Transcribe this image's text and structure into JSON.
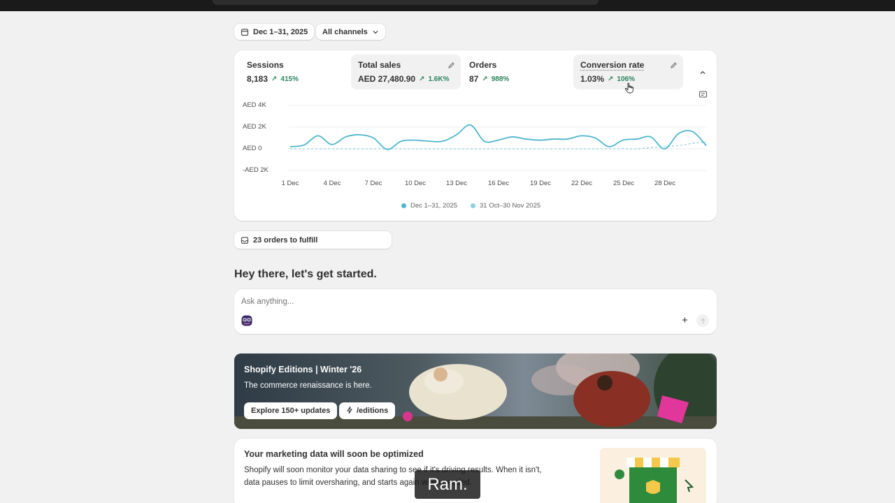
{
  "filters": {
    "date_range": "Dec 1–31, 2025",
    "channel": "All channels"
  },
  "metrics": [
    {
      "label": "Sessions",
      "value": "8,183",
      "change": "415%"
    },
    {
      "label": "Total sales",
      "value": "AED 27,480.90",
      "change": "1.6K%"
    },
    {
      "label": "Orders",
      "value": "87",
      "change": "988%"
    },
    {
      "label": "Conversion rate",
      "value": "1.03%",
      "change": "106%"
    }
  ],
  "chart_data": {
    "type": "line",
    "y_ticks": [
      "AED 4K",
      "AED 2K",
      "AED 0",
      "-AED 2K"
    ],
    "ylim": [
      -2000,
      4000
    ],
    "x_ticks": [
      "1 Dec",
      "4 Dec",
      "7 Dec",
      "10 Dec",
      "13 Dec",
      "16 Dec",
      "19 Dec",
      "22 Dec",
      "25 Dec",
      "28 Dec"
    ],
    "series": [
      {
        "name": "Dec 1–31, 2025",
        "color": "#4cb6cf",
        "dashed": false,
        "x": [
          1,
          2,
          3,
          4,
          5,
          6,
          7,
          8,
          9,
          10,
          11,
          12,
          13,
          14,
          15,
          16,
          17,
          18,
          19,
          20,
          21,
          22,
          23,
          24,
          25,
          26,
          27,
          28,
          29,
          30,
          31
        ],
        "values": [
          200,
          350,
          1200,
          400,
          1100,
          1300,
          1000,
          -50,
          700,
          800,
          700,
          700,
          1300,
          2200,
          700,
          800,
          1100,
          900,
          800,
          900,
          900,
          1200,
          1000,
          200,
          800,
          900,
          1100,
          0,
          1400,
          1600,
          300
        ]
      },
      {
        "name": "31 Oct–30 Nov 2025",
        "color": "#8fd0e0",
        "dashed": true,
        "x": [
          1,
          2,
          3,
          4,
          5,
          6,
          7,
          8,
          9,
          10,
          11,
          12,
          13,
          14,
          15,
          16,
          17,
          18,
          19,
          20,
          21,
          22,
          23,
          24,
          25,
          26,
          27,
          28,
          29,
          30,
          31
        ],
        "values": [
          0,
          0,
          0,
          0,
          0,
          0,
          0,
          0,
          0,
          0,
          0,
          0,
          0,
          0,
          0,
          0,
          0,
          0,
          0,
          0,
          0,
          0,
          0,
          0,
          0,
          0,
          100,
          200,
          300,
          500,
          650
        ]
      }
    ]
  },
  "orders_to_fulfill": "23 orders to fulfill",
  "greeting": "Hey there, let's get started.",
  "ask": {
    "placeholder": "Ask anything..."
  },
  "banner": {
    "title": "Shopify Editions | Winter '26",
    "subtitle": "The commerce renaissance is here.",
    "primary_button": "Explore 150+ updates",
    "secondary_button": "/editions"
  },
  "marketing": {
    "title": "Your marketing data will soon be optimized",
    "body_line1": "Shopify will soon monitor your data sharing to see if it's driving results. When it isn't,",
    "body_line2": "data pauses to limit oversharing, and starts again when needed."
  },
  "caption": "Ram.",
  "colors": {
    "accent": "#4cb6cf",
    "positive": "#29845a"
  }
}
